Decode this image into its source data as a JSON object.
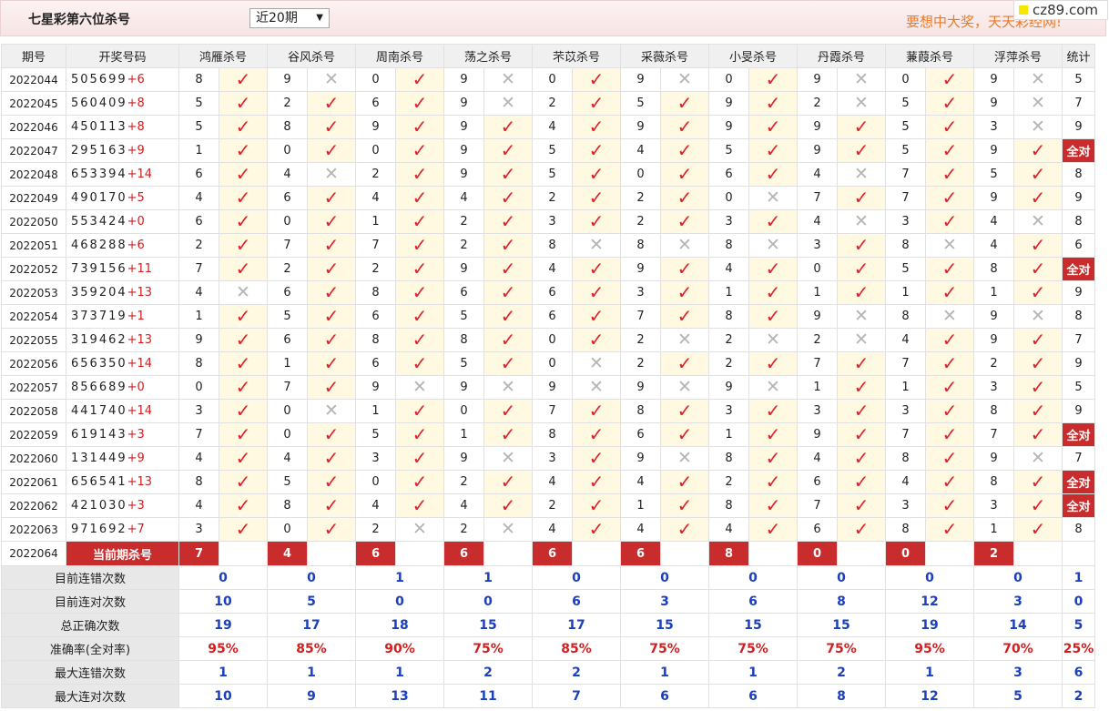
{
  "header": {
    "title": "七星彩第六位杀号",
    "range_select": "近20期",
    "slogan": "要想中大奖，天天彩经网!",
    "watermark": "cz89.com"
  },
  "columns": {
    "period": "期号",
    "draw": "开奖号码",
    "experts": [
      "鸿雁杀号",
      "谷风杀号",
      "周南杀号",
      "荡之杀号",
      "芣苡杀号",
      "采薇杀号",
      "小旻杀号",
      "丹霞杀号",
      "蒹葭杀号",
      "浮萍杀号"
    ],
    "stat": "统计"
  },
  "rows": [
    {
      "period": "2022044",
      "digits": "505699",
      "sum": "+6",
      "picks": [
        "8",
        "9",
        "0",
        "9",
        "0",
        "9",
        "0",
        "9",
        "0",
        "9"
      ],
      "marks": "1010101010",
      "stat": "5"
    },
    {
      "period": "2022045",
      "digits": "560409",
      "sum": "+8",
      "picks": [
        "5",
        "2",
        "6",
        "9",
        "2",
        "5",
        "9",
        "2",
        "5",
        "9"
      ],
      "marks": "1110111010",
      "stat": "7"
    },
    {
      "period": "2022046",
      "digits": "450113",
      "sum": "+8",
      "picks": [
        "5",
        "8",
        "9",
        "9",
        "4",
        "9",
        "9",
        "9",
        "5",
        "3"
      ],
      "marks": "1111111110",
      "stat": "9"
    },
    {
      "period": "2022047",
      "digits": "295163",
      "sum": "+9",
      "picks": [
        "1",
        "0",
        "0",
        "9",
        "5",
        "4",
        "5",
        "9",
        "5",
        "9"
      ],
      "marks": "1111111111",
      "stat": "全对"
    },
    {
      "period": "2022048",
      "digits": "653394",
      "sum": "+14",
      "picks": [
        "6",
        "4",
        "2",
        "9",
        "5",
        "0",
        "6",
        "4",
        "7",
        "5"
      ],
      "marks": "1011111011",
      "stat": "8"
    },
    {
      "period": "2022049",
      "digits": "490170",
      "sum": "+5",
      "picks": [
        "4",
        "6",
        "4",
        "4",
        "2",
        "2",
        "0",
        "7",
        "7",
        "9"
      ],
      "marks": "1111110111",
      "stat": "9"
    },
    {
      "period": "2022050",
      "digits": "553424",
      "sum": "+0",
      "picks": [
        "6",
        "0",
        "1",
        "2",
        "3",
        "2",
        "3",
        "4",
        "3",
        "4"
      ],
      "marks": "1111111010",
      "stat": "8"
    },
    {
      "period": "2022051",
      "digits": "468288",
      "sum": "+6",
      "picks": [
        "2",
        "7",
        "7",
        "2",
        "8",
        "8",
        "8",
        "3",
        "8",
        "4"
      ],
      "marks": "1111000101",
      "stat": "6"
    },
    {
      "period": "2022052",
      "digits": "739156",
      "sum": "+11",
      "picks": [
        "7",
        "2",
        "2",
        "9",
        "4",
        "9",
        "4",
        "0",
        "5",
        "8"
      ],
      "marks": "1111111111",
      "stat": "全对"
    },
    {
      "period": "2022053",
      "digits": "359204",
      "sum": "+13",
      "picks": [
        "4",
        "6",
        "8",
        "6",
        "6",
        "3",
        "1",
        "1",
        "1",
        "1"
      ],
      "marks": "0111111111",
      "stat": "9"
    },
    {
      "period": "2022054",
      "digits": "373719",
      "sum": "+1",
      "picks": [
        "1",
        "5",
        "6",
        "5",
        "6",
        "7",
        "8",
        "9",
        "8",
        "9"
      ],
      "marks": "1111111000",
      "stat": "8"
    },
    {
      "period": "2022055",
      "digits": "319462",
      "sum": "+13",
      "picks": [
        "9",
        "6",
        "8",
        "8",
        "0",
        "2",
        "2",
        "2",
        "4",
        "9"
      ],
      "marks": "1111100011",
      "stat": "7"
    },
    {
      "period": "2022056",
      "digits": "656350",
      "sum": "+14",
      "picks": [
        "8",
        "1",
        "6",
        "5",
        "0",
        "2",
        "2",
        "7",
        "7",
        "2"
      ],
      "marks": "1111011111",
      "stat": "9"
    },
    {
      "period": "2022057",
      "digits": "856689",
      "sum": "+0",
      "picks": [
        "0",
        "7",
        "9",
        "9",
        "9",
        "9",
        "9",
        "1",
        "1",
        "3"
      ],
      "marks": "1100000111",
      "stat": "5"
    },
    {
      "period": "2022058",
      "digits": "441740",
      "sum": "+14",
      "picks": [
        "3",
        "0",
        "1",
        "0",
        "7",
        "8",
        "3",
        "3",
        "3",
        "8"
      ],
      "marks": "1011111111",
      "stat": "9"
    },
    {
      "period": "2022059",
      "digits": "619143",
      "sum": "+3",
      "picks": [
        "7",
        "0",
        "5",
        "1",
        "8",
        "6",
        "1",
        "9",
        "7",
        "7"
      ],
      "marks": "1111111111",
      "stat": "全对"
    },
    {
      "period": "2022060",
      "digits": "131449",
      "sum": "+9",
      "picks": [
        "4",
        "4",
        "3",
        "9",
        "3",
        "9",
        "8",
        "4",
        "8",
        "9"
      ],
      "marks": "1110101110",
      "stat": "7"
    },
    {
      "period": "2022061",
      "digits": "656541",
      "sum": "+13",
      "picks": [
        "8",
        "5",
        "0",
        "2",
        "4",
        "4",
        "2",
        "6",
        "4",
        "8"
      ],
      "marks": "1111111111",
      "stat": "全对"
    },
    {
      "period": "2022062",
      "digits": "421030",
      "sum": "+3",
      "picks": [
        "4",
        "8",
        "4",
        "4",
        "2",
        "1",
        "8",
        "7",
        "3",
        "3"
      ],
      "marks": "1111111111",
      "stat": "全对"
    },
    {
      "period": "2022063",
      "digits": "971692",
      "sum": "+7",
      "picks": [
        "3",
        "0",
        "2",
        "2",
        "4",
        "4",
        "4",
        "6",
        "8",
        "1"
      ],
      "marks": "1100111111",
      "stat": "8"
    }
  ],
  "current": {
    "period": "2022064",
    "label": "当前期杀号",
    "picks": [
      "7",
      "4",
      "6",
      "6",
      "6",
      "6",
      "8",
      "0",
      "0",
      "2"
    ]
  },
  "stats": [
    {
      "label": "目前连错次数",
      "values": [
        "0",
        "0",
        "1",
        "1",
        "0",
        "0",
        "0",
        "0",
        "0",
        "0",
        "1"
      ],
      "type": "count"
    },
    {
      "label": "目前连对次数",
      "values": [
        "10",
        "5",
        "0",
        "0",
        "6",
        "3",
        "6",
        "8",
        "12",
        "3",
        "0"
      ],
      "type": "count"
    },
    {
      "label": "总正确次数",
      "values": [
        "19",
        "17",
        "18",
        "15",
        "17",
        "15",
        "15",
        "15",
        "19",
        "14",
        "5"
      ],
      "type": "count"
    },
    {
      "label": "准确率(全对率)",
      "values": [
        "95%",
        "85%",
        "90%",
        "75%",
        "85%",
        "75%",
        "75%",
        "75%",
        "95%",
        "70%",
        "25%"
      ],
      "type": "pct"
    },
    {
      "label": "最大连错次数",
      "values": [
        "1",
        "1",
        "1",
        "2",
        "2",
        "1",
        "1",
        "2",
        "1",
        "3",
        "6"
      ],
      "type": "count"
    },
    {
      "label": "最大连对次数",
      "values": [
        "10",
        "9",
        "13",
        "11",
        "7",
        "6",
        "6",
        "8",
        "12",
        "5",
        "2"
      ],
      "type": "count"
    }
  ],
  "colors": {
    "accent_red": "#c82c2c",
    "check_red": "#e0202a",
    "stat_blue": "#1a3fbf",
    "slogan_orange": "#e87a2a"
  },
  "icons": {
    "correct": "check-icon",
    "wrong": "cross-icon",
    "dropdown": "chevron-down-icon"
  }
}
